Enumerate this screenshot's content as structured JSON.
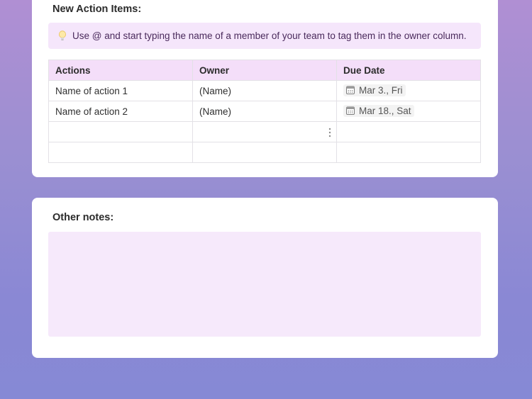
{
  "action_items": {
    "heading": "New Action Items:",
    "callout_icon": "lightbulb-icon",
    "callout_text": "Use @ and start typing the name of a member of your team to tag them in the owner column.",
    "columns": [
      "Actions",
      "Owner",
      "Due Date"
    ],
    "rows": [
      {
        "action": "Name of action 1",
        "owner": "(Name)",
        "due": "Mar 3., Fri"
      },
      {
        "action": "Name of action 2",
        "owner": "(Name)",
        "due": "Mar 18., Sat"
      },
      {
        "action": "",
        "owner": "",
        "due": ""
      },
      {
        "action": "",
        "owner": "",
        "due": ""
      }
    ]
  },
  "other_notes": {
    "heading": "Other notes:",
    "body": ""
  },
  "colors": {
    "header_bg": "#f4def9",
    "callout_bg": "#f5e6fb",
    "notes_bg": "#f6e9fb"
  }
}
